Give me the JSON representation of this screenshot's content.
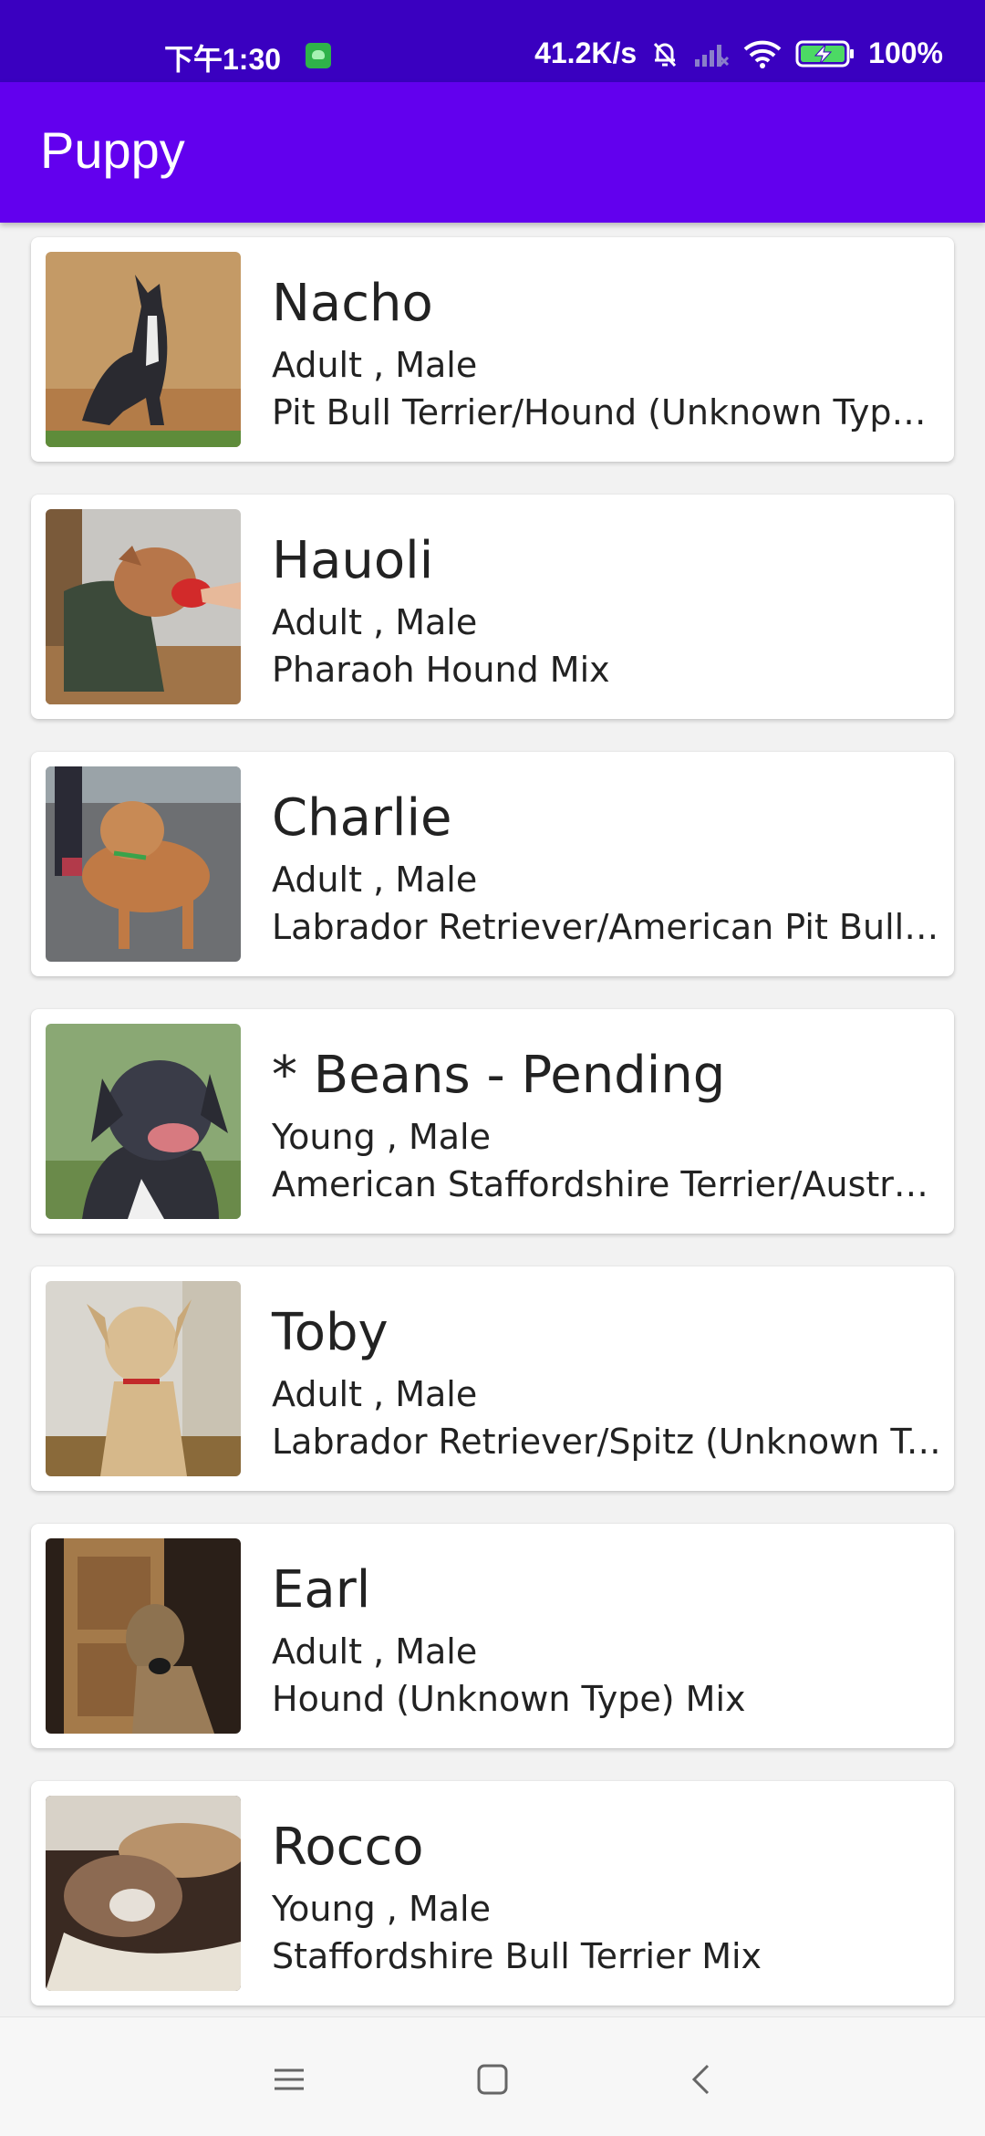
{
  "status_bar": {
    "time": "下午1:30",
    "net_speed": "41.2K/s",
    "battery": "100%"
  },
  "app_bar": {
    "title": "Puppy",
    "color": "#6200ee"
  },
  "puppies": [
    {
      "name": "Nacho",
      "age_gender": "Adult , Male",
      "breed": "Pit Bull Terrier/Hound (Unknown Type) Mix"
    },
    {
      "name": "Hauoli",
      "age_gender": "Adult , Male",
      "breed": "Pharaoh Hound Mix"
    },
    {
      "name": "Charlie",
      "age_gender": "Adult , Male",
      "breed": "Labrador Retriever/American Pit Bull Terrier Mix"
    },
    {
      "name": "* Beans - Pending",
      "age_gender": "Young , Male",
      "breed": "American Staffordshire Terrier/Australian Shepherd Mix"
    },
    {
      "name": "Toby",
      "age_gender": "Adult , Male",
      "breed": "Labrador Retriever/Spitz (Unknown Type) Mix"
    },
    {
      "name": "Earl",
      "age_gender": "Adult , Male",
      "breed": "Hound (Unknown Type) Mix"
    },
    {
      "name": "Rocco",
      "age_gender": "Young , Male",
      "breed": "Staffordshire Bull Terrier Mix"
    }
  ],
  "icons": {
    "status": [
      "app-notification-icon",
      "mute-bell-icon",
      "signal-icon",
      "wifi-icon",
      "battery-charging-icon"
    ],
    "nav": [
      "menu-icon",
      "home-icon",
      "back-icon"
    ]
  }
}
